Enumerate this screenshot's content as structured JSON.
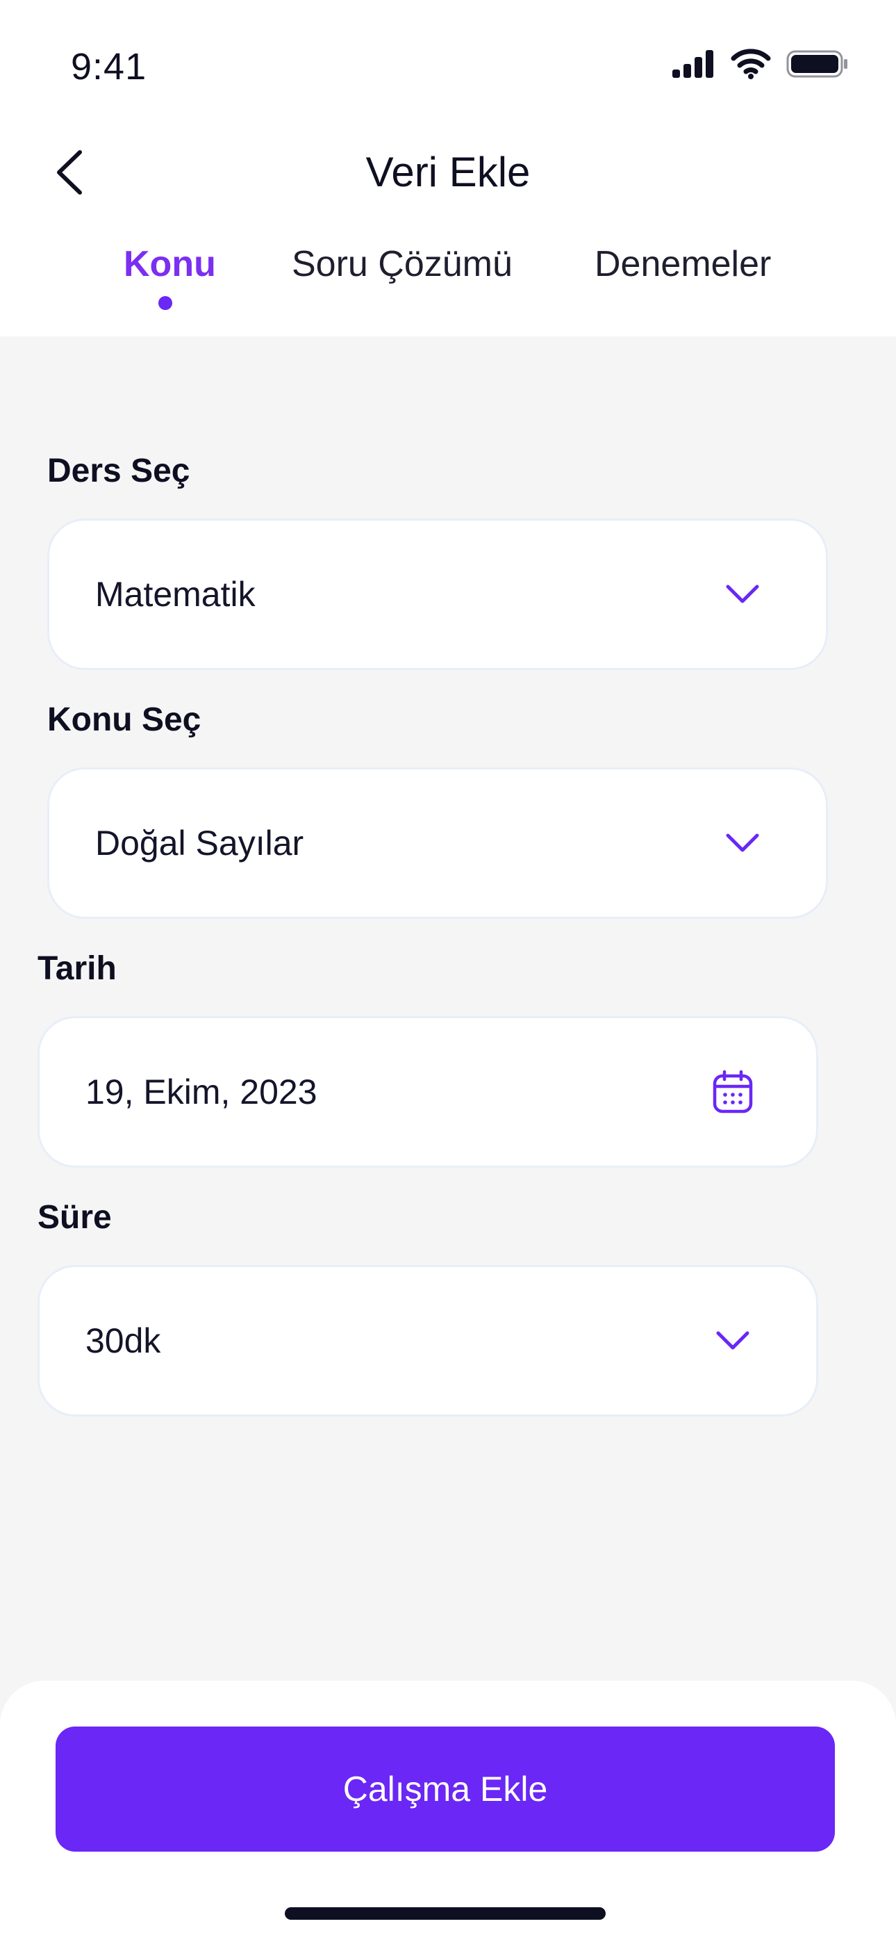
{
  "status_bar": {
    "time": "9:41"
  },
  "header": {
    "title": "Veri Ekle",
    "back_icon": "chevron-left-icon"
  },
  "tabs": [
    {
      "label": "Konu",
      "active": true
    },
    {
      "label": "Soru Çözümü",
      "active": false
    },
    {
      "label": "Denemeler",
      "active": false
    }
  ],
  "form": {
    "course": {
      "label": "Ders Seç",
      "value": "Matematik",
      "icon": "chevron-down-icon"
    },
    "topic": {
      "label": "Konu Seç",
      "value": "Doğal Sayılar",
      "icon": "chevron-down-icon"
    },
    "date": {
      "label": "Tarih",
      "value": "19, Ekim, 2023",
      "icon": "calendar-icon"
    },
    "duration": {
      "label": "Süre",
      "value": "30dk",
      "icon": "chevron-down-icon"
    }
  },
  "footer": {
    "primary_button_label": "Çalışma Ekle"
  },
  "colors": {
    "accent": "#6A27F5",
    "accent_text": "#7B2FF0",
    "background": "#F5F5F6",
    "surface": "#FFFFFF",
    "text_primary": "#0F0F22"
  }
}
